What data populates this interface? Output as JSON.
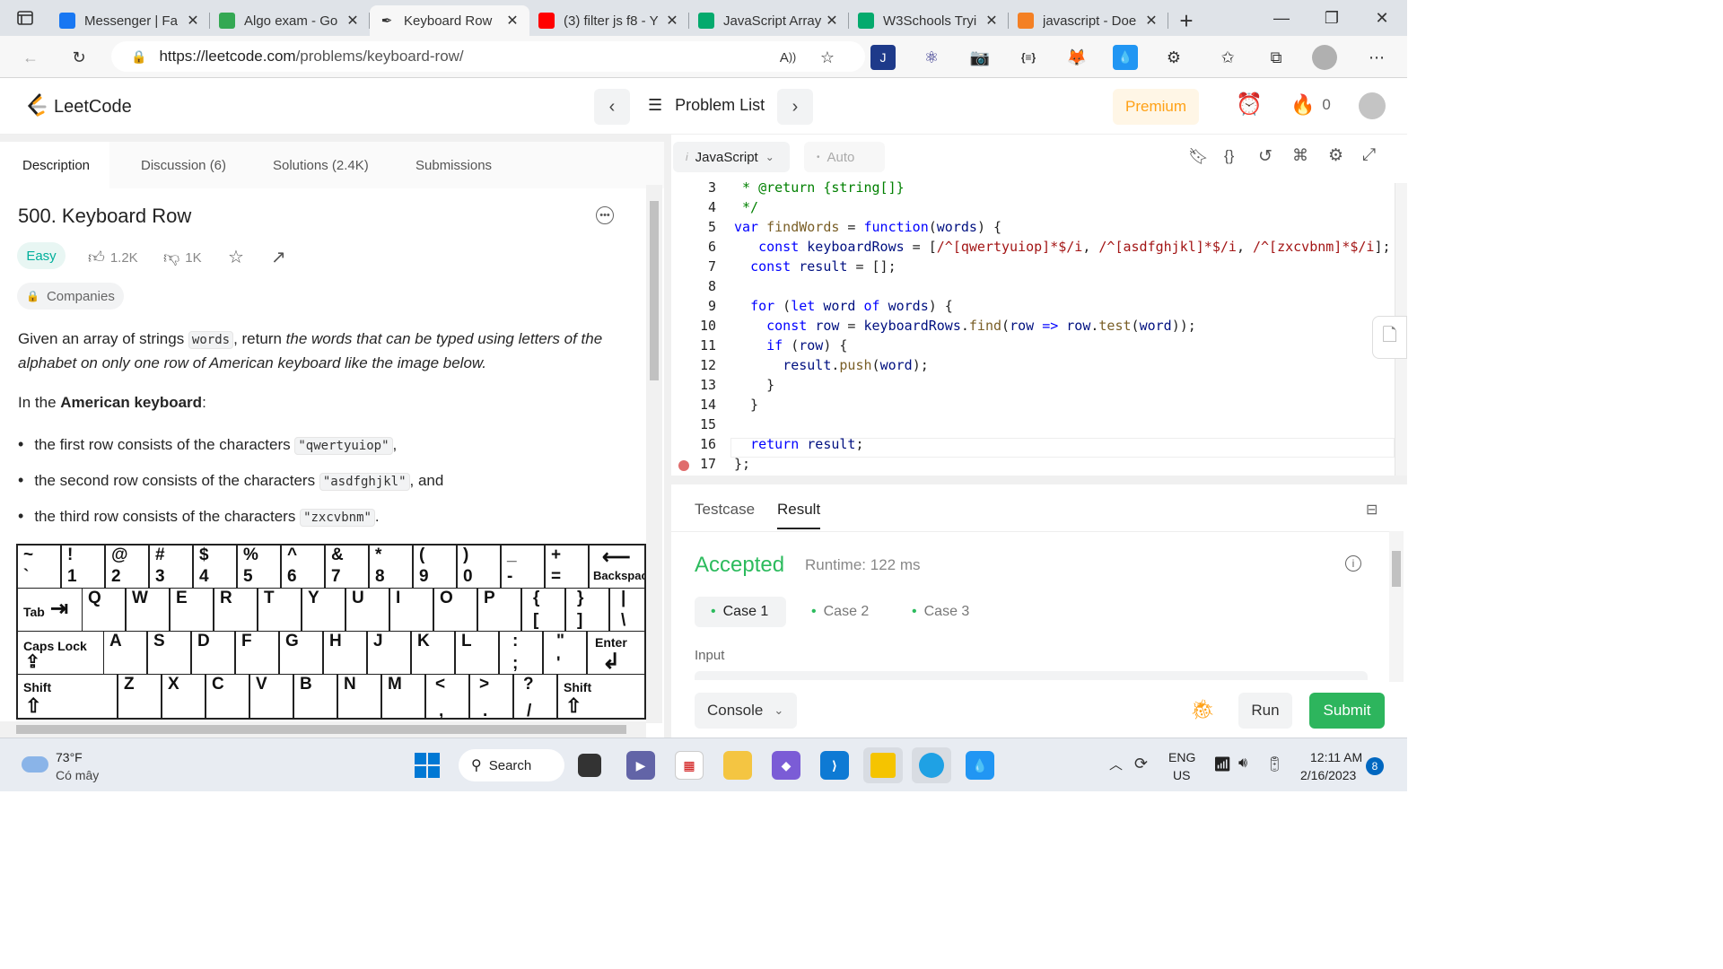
{
  "browser": {
    "tabs": [
      {
        "label": "Messenger | Fa",
        "icon": "facebook-icon",
        "color": "#1877f2"
      },
      {
        "label": "Algo exam - Go",
        "icon": "sheets-icon",
        "color": "#34a853"
      },
      {
        "label": "Keyboard Row",
        "icon": "leetcode-icon",
        "color": "#f7f7f7",
        "active": true
      },
      {
        "label": "(3) filter js f8 - Y",
        "icon": "youtube-icon",
        "color": "#ff0000"
      },
      {
        "label": "JavaScript Array",
        "icon": "w3schools-icon",
        "color": "#04aa6d"
      },
      {
        "label": "W3Schools Tryi",
        "icon": "w3schools-icon",
        "color": "#04aa6d"
      },
      {
        "label": "javascript - Doe",
        "icon": "stackoverflow-icon",
        "color": "#f48024"
      }
    ],
    "new_tab": "+",
    "url_host": "https://leetcode.com",
    "url_path": "/problems/keyboard-row/"
  },
  "header": {
    "logo": "LeetCode",
    "problem_list": "Problem List",
    "premium": "Premium",
    "fire_count": "0"
  },
  "left": {
    "tabs": [
      "Description",
      "Discussion (6)",
      "Solutions (2.4K)",
      "Submissions"
    ],
    "title": "500. Keyboard Row",
    "difficulty": "Easy",
    "likes": "1.2K",
    "dislikes": "1K",
    "companies": "Companies",
    "p1_a": "Given an array of strings ",
    "p1_code": "words",
    "p1_b": ", return ",
    "p1_em": "the words that can be typed using letters of the alphabet on only one row of American keyboard like the image below.",
    "p2_a": "In the ",
    "p2_b": "American keyboard",
    "p2_c": ":",
    "bullets": [
      {
        "pre": "the first row consists of the characters ",
        "code": "\"qwertyuiop\"",
        "post": ","
      },
      {
        "pre": "the second row consists of the characters ",
        "code": "\"asdfghjkl\"",
        "post": ", and"
      },
      {
        "pre": "the third row consists of the characters ",
        "code": "\"zxcvbnm\"",
        "post": "."
      }
    ],
    "keyboard": {
      "row1": [
        [
          "~",
          "`"
        ],
        [
          "!",
          "1"
        ],
        [
          "@",
          "2"
        ],
        [
          "#",
          "3"
        ],
        [
          "$",
          "4"
        ],
        [
          "%",
          "5"
        ],
        [
          "^",
          "6"
        ],
        [
          "&",
          "7"
        ],
        [
          "*",
          "8"
        ],
        [
          "(",
          "9"
        ],
        [
          ")",
          "0"
        ],
        [
          "_",
          "-"
        ],
        [
          "+",
          "="
        ]
      ],
      "backspace": "Backspace",
      "tab": "Tab",
      "row2": [
        "Q",
        "W",
        "E",
        "R",
        "T",
        "Y",
        "U",
        "I",
        "O",
        "P"
      ],
      "row2_sym": [
        [
          "{",
          "["
        ],
        [
          "}",
          "]"
        ],
        [
          "|",
          "\\"
        ]
      ],
      "caps": "Caps Lock",
      "row3": [
        "A",
        "S",
        "D",
        "F",
        "G",
        "H",
        "J",
        "K",
        "L"
      ],
      "row3_sym": [
        [
          ":",
          ";"
        ],
        [
          "\"",
          "'"
        ]
      ],
      "enter": "Enter",
      "shift": "Shift",
      "row4": [
        "Z",
        "X",
        "C",
        "V",
        "B",
        "N",
        "M"
      ],
      "row4_sym": [
        [
          "<",
          ","
        ],
        [
          ">",
          "."
        ],
        [
          "?",
          "/"
        ]
      ]
    }
  },
  "editor": {
    "language": "JavaScript",
    "mode": "Auto",
    "lines": [
      {
        "n": "3",
        "html": "<span class='ct'> * @return {string[]}</span>"
      },
      {
        "n": "4",
        "html": "<span class='ct'> */</span>"
      },
      {
        "n": "5",
        "html": "<span class='kw'>var</span> <span class='fn'>findWords</span> = <span class='kw'>function</span>(<span class='vr'>words</span>) {"
      },
      {
        "n": "6",
        "html": "   <span class='kw'>const</span> <span class='vr'>keyboardRows</span> = [<span class='rx'>/^[qwertyuiop]*$/i</span>, <span class='rx'>/^[asdfghjkl]*$/i</span>, <span class='rx'>/^[zxcvbnm]*$/i</span>];"
      },
      {
        "n": "7",
        "html": "  <span class='kw'>const</span> <span class='vr'>result</span> = [];"
      },
      {
        "n": "8",
        "html": ""
      },
      {
        "n": "9",
        "html": "  <span class='kw'>for</span> (<span class='kw'>let</span> <span class='vr'>word</span> <span class='kw'>of</span> <span class='vr'>words</span>) {"
      },
      {
        "n": "10",
        "html": "    <span class='kw'>const</span> <span class='vr'>row</span> = <span class='vr'>keyboardRows</span>.<span class='fn'>find</span>(<span class='vr'>row</span> <span class='kw'>=&gt;</span> <span class='vr'>row</span>.<span class='fn'>test</span>(<span class='vr'>word</span>));"
      },
      {
        "n": "11",
        "html": "    <span class='kw'>if</span> (<span class='vr'>row</span>) {"
      },
      {
        "n": "12",
        "html": "      <span class='vr'>result</span>.<span class='fn'>push</span>(<span class='vr'>word</span>);"
      },
      {
        "n": "13",
        "html": "    }"
      },
      {
        "n": "14",
        "html": "  }"
      },
      {
        "n": "15",
        "html": ""
      },
      {
        "n": "16",
        "html": "  <span class='kw'>return</span> <span class='vr'>result</span>;"
      },
      {
        "n": "17",
        "html": "};"
      }
    ]
  },
  "console": {
    "tabs": [
      "Testcase",
      "Result"
    ],
    "status": "Accepted",
    "runtime": "Runtime: 122 ms",
    "cases": [
      "Case 1",
      "Case 2",
      "Case 3"
    ],
    "input_label": "Input",
    "console_btn": "Console",
    "run": "Run",
    "submit": "Submit"
  },
  "taskbar": {
    "weather_temp": "73°F",
    "weather_desc": "Có mây",
    "search": "Search",
    "lang1": "ENG",
    "lang2": "US",
    "time": "12:11 AM",
    "date": "2/16/2023",
    "notif": "8"
  },
  "colors": {
    "accepted": "#2cbb5d",
    "easy": "#00af9b",
    "premium": "#ffa116",
    "submit": "#2db55d"
  }
}
